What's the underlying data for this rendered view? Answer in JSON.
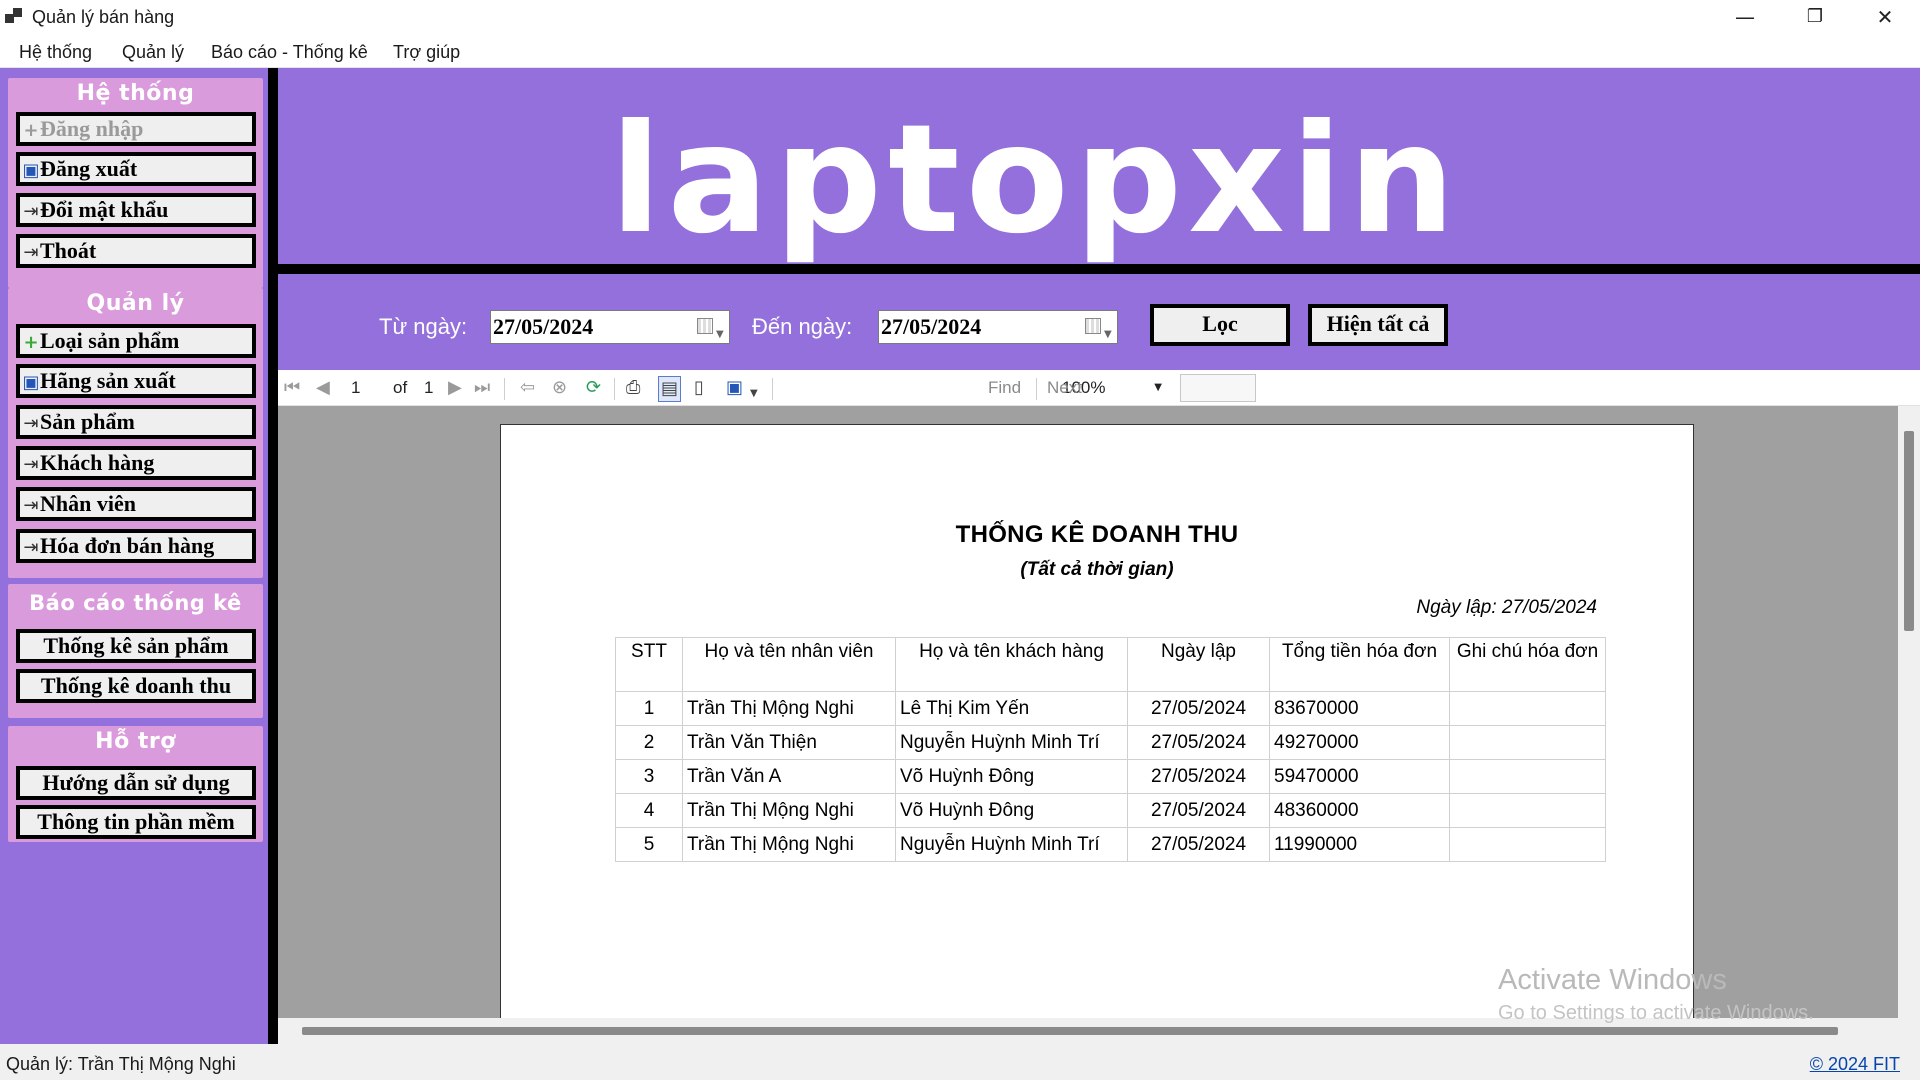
{
  "window": {
    "title": "Quản lý bán hàng",
    "minimize_glyph": "—",
    "restore_glyph": "❐",
    "close_glyph": "✕"
  },
  "menu": [
    "Hệ thống",
    "Quản lý",
    "Báo cáo - Thống kê",
    "Trợ giúp"
  ],
  "sidebar": {
    "groups": [
      {
        "title": "Hệ thống",
        "items": [
          {
            "label": "Đăng nhập",
            "icon": "plus-icon",
            "enabled": false
          },
          {
            "label": "Đăng xuất",
            "icon": "disk-icon",
            "enabled": true
          },
          {
            "label": "Đổi mật khẩu",
            "icon": "exit-icon",
            "enabled": true
          },
          {
            "label": "Thoát",
            "icon": "exit-icon",
            "enabled": true
          }
        ]
      },
      {
        "title": "Quản lý",
        "items": [
          {
            "label": "Loại sản phẩm",
            "icon": "plus-icon",
            "enabled": true
          },
          {
            "label": "Hãng sản xuất",
            "icon": "disk-icon",
            "enabled": true
          },
          {
            "label": "Sản phẩm",
            "icon": "exit-icon",
            "enabled": true
          },
          {
            "label": "Khách hàng",
            "icon": "exit-icon",
            "enabled": true
          },
          {
            "label": "Nhân viên",
            "icon": "exit-icon",
            "enabled": true
          },
          {
            "label": "Hóa đơn bán hàng",
            "icon": "exit-icon",
            "enabled": true
          }
        ]
      },
      {
        "title": "Báo cáo thống kê",
        "items": [
          {
            "label": "Thống kê sản phẩm"
          },
          {
            "label": "Thống kê doanh thu"
          }
        ]
      },
      {
        "title": "Hỗ trợ",
        "items": [
          {
            "label": "Hướng dẫn sử dụng"
          },
          {
            "label": "Thông tin phần mềm"
          }
        ]
      }
    ]
  },
  "banner": {
    "logo": "laptopxin"
  },
  "filter": {
    "from_label": "Từ ngày:",
    "from_value": "27/05/2024",
    "to_label": "Đến ngày:",
    "to_value": "27/05/2024",
    "filter_button": "Lọc",
    "show_all_button": "Hiện tất cả"
  },
  "report_toolbar": {
    "page_current": "1",
    "page_of": "of",
    "page_total": "1",
    "zoom": "100%",
    "find": "Find",
    "next": "Next"
  },
  "report": {
    "title": "THỐNG KÊ DOANH THU",
    "subtitle": "(Tất cả thời gian)",
    "created_date": "Ngày lập: 27/05/2024",
    "columns": [
      "STT",
      "Họ và tên nhân viên",
      "Họ và tên khách hàng",
      "Ngày lập",
      "Tổng tiền hóa đơn",
      "Ghi chú hóa đơn"
    ],
    "rows": [
      [
        "1",
        "Trần Thị Mộng Nghi",
        "Lê Thị Kim Yến",
        "27/05/2024",
        "83670000",
        ""
      ],
      [
        "2",
        "Trần Văn Thiện",
        "Nguyễn Huỳnh Minh Trí",
        "27/05/2024",
        "49270000",
        ""
      ],
      [
        "3",
        "Trần Văn A",
        "Võ Huỳnh Đông",
        "27/05/2024",
        "59470000",
        ""
      ],
      [
        "4",
        "Trần Thị Mộng Nghi",
        "Võ Huỳnh Đông",
        "27/05/2024",
        "48360000",
        ""
      ],
      [
        "5",
        "Trần Thị Mộng Nghi",
        "Nguyễn Huỳnh Minh Trí",
        "27/05/2024",
        "11990000",
        ""
      ]
    ]
  },
  "watermark": {
    "line1": "Activate Windows",
    "line2": "Go to Settings to activate Windows."
  },
  "status": {
    "user": "Quản lý: Trần Thị Mộng Nghi",
    "copyright": "© 2024 FIT"
  },
  "colors": {
    "purple": "#9370db",
    "pink": "#da9bdc",
    "black": "#000000"
  }
}
